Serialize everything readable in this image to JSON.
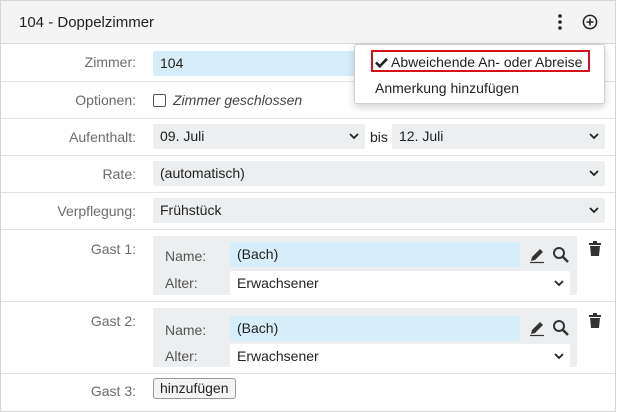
{
  "header": {
    "title": "104 - Doppelzimmer"
  },
  "room": {
    "label": "Zimmer:",
    "value": "104"
  },
  "options": {
    "label": "Optionen:",
    "closed_label": "Zimmer geschlossen"
  },
  "stay": {
    "label": "Aufenthalt:",
    "from": "09. Juli",
    "separator": "bis",
    "to": "12. Juli"
  },
  "rate": {
    "label": "Rate:",
    "value": "(automatisch)"
  },
  "board": {
    "label": "Verpflegung:",
    "value": "Frühstück"
  },
  "guests": [
    {
      "label": "Gast 1:",
      "name_label": "Name:",
      "name": "(Bach)",
      "age_label": "Alter:",
      "age": "Erwachsener"
    },
    {
      "label": "Gast 2:",
      "name_label": "Name:",
      "name": "(Bach)",
      "age_label": "Alter:",
      "age": "Erwachsener"
    }
  ],
  "guest3": {
    "label": "Gast 3:",
    "add_label": "hinzufügen"
  },
  "menu": {
    "items": [
      {
        "label": "Abweichende An- oder Abreise",
        "checked": true
      },
      {
        "label": "Anmerkung hinzufügen",
        "checked": false
      }
    ]
  },
  "colors": {
    "highlight_border": "#d4121b",
    "field_blue": "#d6eefa",
    "select_gray": "#eceeef"
  }
}
